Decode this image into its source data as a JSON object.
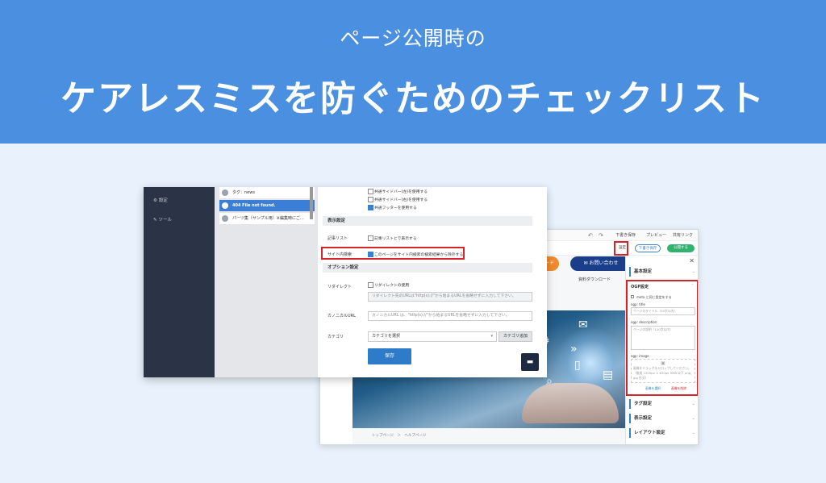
{
  "banner": {
    "subtitle": "ページ公開時の",
    "title": "ケアレスミスを防ぐためのチェックリスト"
  },
  "editor_admin": {
    "sidebar": [
      {
        "icon": "gear-icon",
        "label": "設定"
      },
      {
        "icon": "wrench-icon",
        "label": "ツール"
      }
    ],
    "page_list": [
      {
        "label": "タグ：news",
        "selected": false
      },
      {
        "label": "404 File not found.",
        "selected": true
      },
      {
        "label": "パーツ集（サンプル用）※編集時にご…",
        "selected": false
      }
    ],
    "checkboxes_top": [
      {
        "label": "共通サイドバー(左)を使用する",
        "checked": false
      },
      {
        "label": "共通サイドバー(右)を使用する",
        "checked": false
      },
      {
        "label": "共通フッターを使用する",
        "checked": true
      }
    ],
    "display_section": "表示設定",
    "article_list_label": "記事リスト",
    "article_list_option": "記事リストとで表示する",
    "site_search_label": "サイト内検索",
    "site_search_option": "このページをサイト内検索の検索結果から除外する",
    "option_section": "オプション設定",
    "redirect_label": "リダイレクト",
    "redirect_option": "リダイレクトの使用",
    "redirect_placeholder": "リダイレクト先のURLは\"http(s)://\"から始まるURLを省略せずに入力して下さい。",
    "canonical_label": "カノニカルURL",
    "canonical_placeholder": "カノニカルURL は、\"http(s)://\"から始まるURLを省略せずに入力して下さい。",
    "category_label": "カテゴリ",
    "category_select": "カテゴリを選択",
    "category_add": "カテゴリ追加",
    "save_label": "保存"
  },
  "site_editor": {
    "toolbar": {
      "undo": "↶",
      "redo": "↷",
      "draft_save": "下書き保存",
      "preview": "プレビュー",
      "share_link": "共有リンク",
      "settings": "設定",
      "draft_save_btn": "下書き保存",
      "publish_btn": "公開する"
    },
    "orange_button": "ロード",
    "contact_button": "お問い合わせ",
    "nav_item": "資料ダウンロード",
    "breadcrumb": "トップページ　＞　ヘルプページ",
    "panel": {
      "basic": "基本設定",
      "ogp": "OGP設定",
      "meta_option": "meta と同じ設定をする",
      "ogp_title_label": "ogp: title",
      "ogp_title_placeholder": "ページのタイトル（50字以内）",
      "ogp_desc_label": "ogp: description",
      "ogp_desc_placeholder": "ページの説明（120字以内）",
      "ogp_image_label": "ogp: image",
      "ogp_image_hint": "画像をドラッグ＆ドロップしてください。（推奨 1200px × 630px 5MB 以下 png, jpg 形式）",
      "select_image": "画像を選択",
      "delete_image": "画像を削除",
      "tag": "タグ設定",
      "display": "表示設定",
      "layout": "レイアウト設定"
    }
  },
  "colors": {
    "banner": "#4a8fe0",
    "background": "#e9f2fc",
    "highlight": "#d5232a",
    "primary": "#2d7bc9",
    "publish": "#2fb36f"
  }
}
